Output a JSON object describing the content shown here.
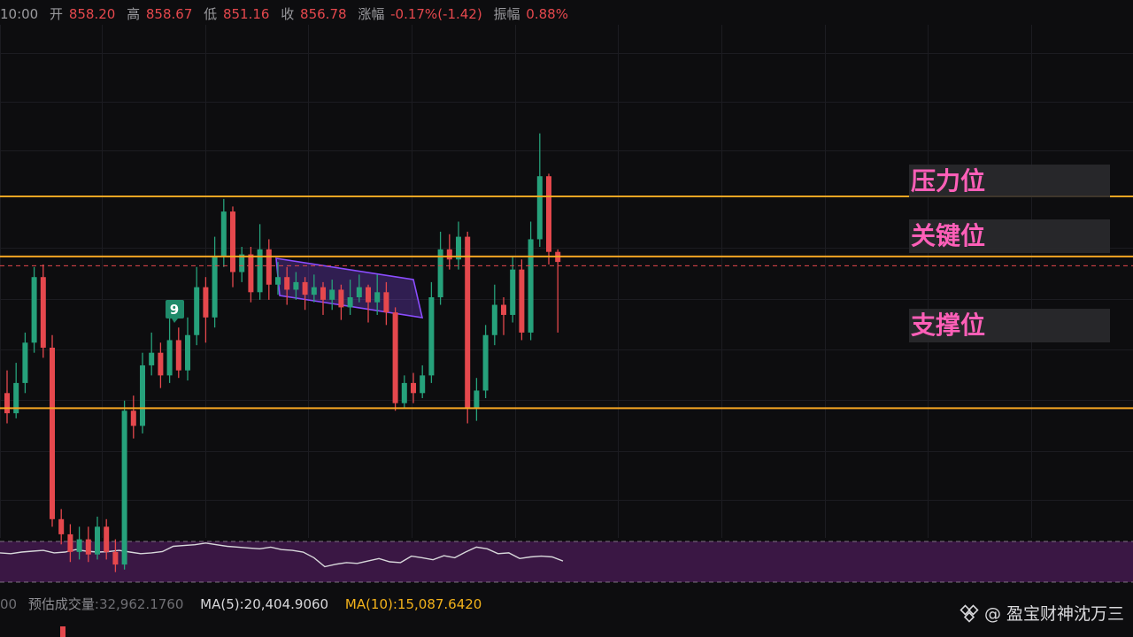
{
  "header": {
    "time": "10:00",
    "open_label": "开",
    "open": "858.20",
    "high_label": "高",
    "high": "858.67",
    "low_label": "低",
    "low": "851.16",
    "close_label": "收",
    "close": "856.78",
    "change_label": "涨幅",
    "change": "-0.17%(-1.42)",
    "amplitude_label": "振幅",
    "amplitude": "0.88%"
  },
  "levels": {
    "resistance_label": "压力位",
    "key_label": "关键位",
    "support_label": "支撑位",
    "line_color": "#f5a623",
    "label_color": "#ff5fb8"
  },
  "marker": {
    "label": "9",
    "color": "#1f8a6a"
  },
  "footer": {
    "time_fragment": "00",
    "est_volume_label": "预估成交量",
    "est_volume": ":32,962.1760",
    "ma5": "MA(5):20,404.9060",
    "ma10": "MA(10):15,087.6420"
  },
  "watermark": {
    "at": "@",
    "author": "盈宝财神沈万三"
  },
  "colors": {
    "up": "#26a17b",
    "down": "#e5484d",
    "channel": "#8b4dff",
    "volume_band": "#3a1744",
    "volume_line": "#d7d7da"
  },
  "chart_data": {
    "type": "candlestick",
    "price_levels": {
      "resistance": 861.0,
      "key": 858.6,
      "support": 852.6
    },
    "candles": [
      [
        853.2,
        852.4,
        854.1,
        852.0
      ],
      [
        852.4,
        853.6,
        854.4,
        852.2
      ],
      [
        853.6,
        855.2,
        855.6,
        853.2
      ],
      [
        855.2,
        857.8,
        858.2,
        854.8
      ],
      [
        857.8,
        855.0,
        858.3,
        854.6
      ],
      [
        855.0,
        848.2,
        855.5,
        847.9
      ],
      [
        848.2,
        847.6,
        848.6,
        847.2
      ],
      [
        847.6,
        846.9,
        848.0,
        846.5
      ],
      [
        846.9,
        847.4,
        847.9,
        846.6
      ],
      [
        847.4,
        846.8,
        847.9,
        846.5
      ],
      [
        846.8,
        847.9,
        848.3,
        846.6
      ],
      [
        847.9,
        846.9,
        848.2,
        846.6
      ],
      [
        846.9,
        846.4,
        847.4,
        846.1
      ],
      [
        846.4,
        852.5,
        852.9,
        846.2
      ],
      [
        852.5,
        851.9,
        853.1,
        851.4
      ],
      [
        851.9,
        854.3,
        854.8,
        851.6
      ],
      [
        854.3,
        854.8,
        855.6,
        853.9
      ],
      [
        854.8,
        853.9,
        855.2,
        853.4
      ],
      [
        853.9,
        855.3,
        856.8,
        853.6
      ],
      [
        855.3,
        854.1,
        855.8,
        853.8
      ],
      [
        854.1,
        855.5,
        856.2,
        853.7
      ],
      [
        855.5,
        857.4,
        858.2,
        855.1
      ],
      [
        857.4,
        856.2,
        857.8,
        855.2
      ],
      [
        856.2,
        858.6,
        859.4,
        855.8
      ],
      [
        858.6,
        860.4,
        860.9,
        858.2
      ],
      [
        860.4,
        858.0,
        860.6,
        857.4
      ],
      [
        858.0,
        858.7,
        859.0,
        857.6
      ],
      [
        858.7,
        857.2,
        859.0,
        856.8
      ],
      [
        857.2,
        858.9,
        859.9,
        856.9
      ],
      [
        858.9,
        857.5,
        859.3,
        856.9
      ],
      [
        857.5,
        857.8,
        858.4,
        857.1
      ],
      [
        857.8,
        857.3,
        858.2,
        856.7
      ],
      [
        857.3,
        857.6,
        858.0,
        856.9
      ],
      [
        857.6,
        857.1,
        857.8,
        856.5
      ],
      [
        857.1,
        857.4,
        857.9,
        856.8
      ],
      [
        857.4,
        856.9,
        857.6,
        856.3
      ],
      [
        856.9,
        857.3,
        857.7,
        856.5
      ],
      [
        857.3,
        856.6,
        857.5,
        856.1
      ],
      [
        856.6,
        857.0,
        857.7,
        856.3
      ],
      [
        857.0,
        857.4,
        857.9,
        856.8
      ],
      [
        857.4,
        856.8,
        857.5,
        856.0
      ],
      [
        856.8,
        857.2,
        857.9,
        856.3
      ],
      [
        857.2,
        856.4,
        857.6,
        855.9
      ],
      [
        856.4,
        852.8,
        856.6,
        852.5
      ],
      [
        852.8,
        853.6,
        853.9,
        852.6
      ],
      [
        853.6,
        853.2,
        854.0,
        852.8
      ],
      [
        853.2,
        853.9,
        854.3,
        853.0
      ],
      [
        853.9,
        857.0,
        857.6,
        853.6
      ],
      [
        857.0,
        858.9,
        859.6,
        856.7
      ],
      [
        858.9,
        858.5,
        859.5,
        858.1
      ],
      [
        858.5,
        859.4,
        860.0,
        858.1
      ],
      [
        859.4,
        852.6,
        859.6,
        852.0
      ],
      [
        852.6,
        853.3,
        853.8,
        852.1
      ],
      [
        853.3,
        855.5,
        855.9,
        853.0
      ],
      [
        855.5,
        856.7,
        857.5,
        855.1
      ],
      [
        856.7,
        856.3,
        857.0,
        855.5
      ],
      [
        856.3,
        858.1,
        858.6,
        856.0
      ],
      [
        858.1,
        855.6,
        858.5,
        855.3
      ],
      [
        855.6,
        859.3,
        860.0,
        855.3
      ],
      [
        859.3,
        861.8,
        863.5,
        859.0
      ],
      [
        861.8,
        858.8,
        861.9,
        858.3
      ],
      [
        858.8,
        858.4,
        858.9,
        855.6
      ]
    ],
    "volume_series": [
      0.72,
      0.7,
      0.74,
      0.76,
      0.78,
      0.72,
      0.74,
      0.8,
      0.76,
      0.74,
      0.75,
      0.78,
      0.74,
      0.7,
      0.72,
      0.75,
      0.88,
      0.9,
      0.92,
      0.96,
      0.92,
      0.88,
      0.86,
      0.84,
      0.82,
      0.86,
      0.8,
      0.78,
      0.74,
      0.6,
      0.38,
      0.44,
      0.48,
      0.46,
      0.52,
      0.58,
      0.5,
      0.48,
      0.64,
      0.6,
      0.55,
      0.65,
      0.6,
      0.74,
      0.86,
      0.82,
      0.7,
      0.72,
      0.58,
      0.62,
      0.64,
      0.62,
      0.52
    ]
  }
}
